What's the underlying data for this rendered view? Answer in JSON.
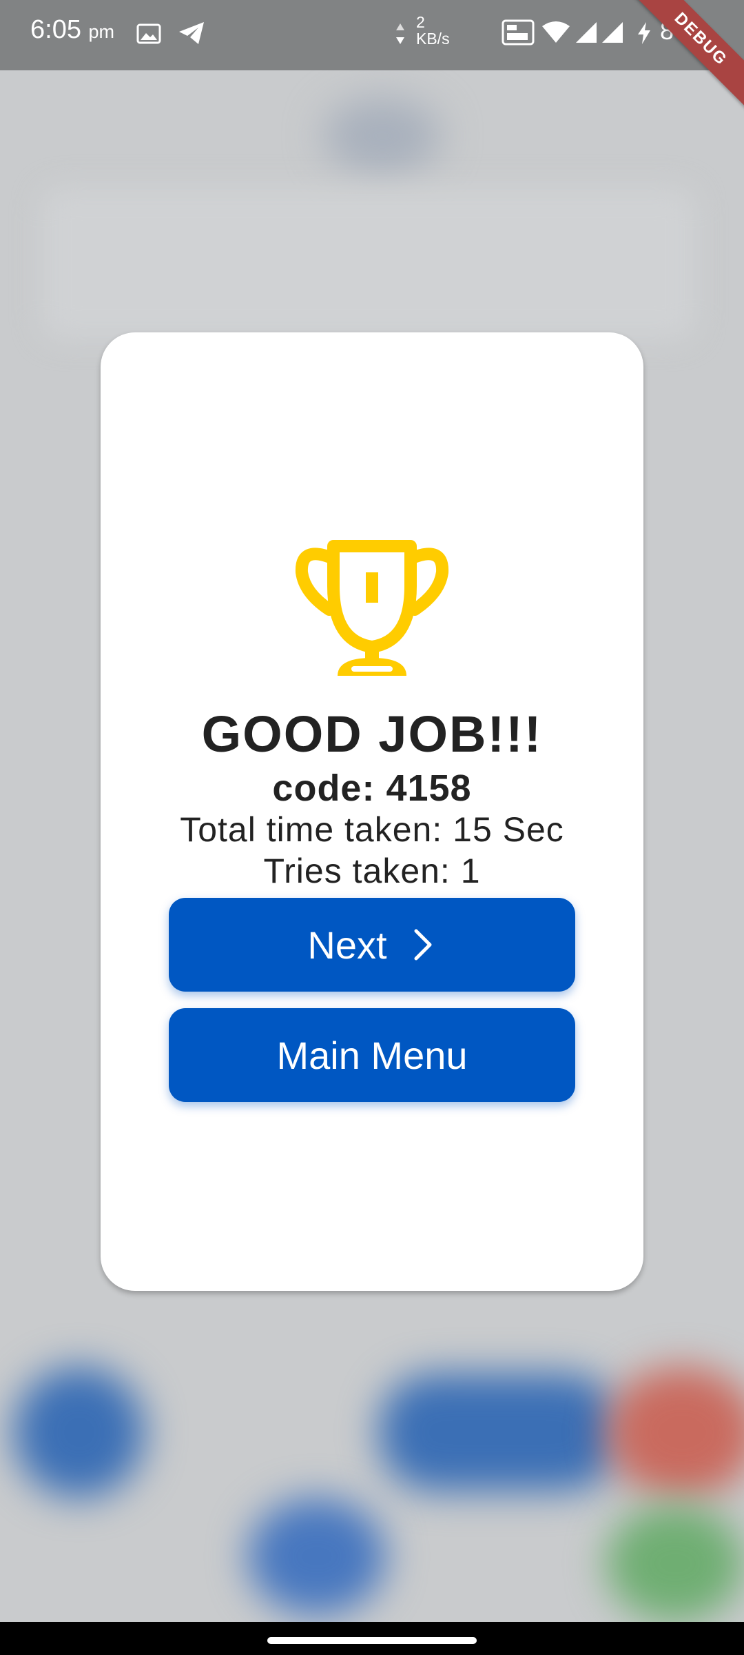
{
  "status_bar": {
    "time": "6:05",
    "ampm": "pm",
    "net_speed_value": "2",
    "net_speed_unit": "KB/s",
    "battery": "87%",
    "debug_label": "DEBUG",
    "icons": [
      "gallery-icon",
      "telegram-icon",
      "data-arrows-icon",
      "volte-icon",
      "wifi-icon",
      "signal-icon",
      "signal-icon",
      "charging-icon"
    ]
  },
  "dialog": {
    "icon": "trophy-icon",
    "title": "GOOD JOB!!!",
    "code": "code: 4158",
    "time_taken": "Total time taken: 15 Sec",
    "tries": "Tries taken: 1",
    "next_label": "Next",
    "main_menu_label": "Main Menu"
  },
  "colors": {
    "accent": "#0057c2",
    "trophy": "#ffcc00",
    "status_bar": "#818384",
    "debug_ribbon": "#a94442"
  }
}
